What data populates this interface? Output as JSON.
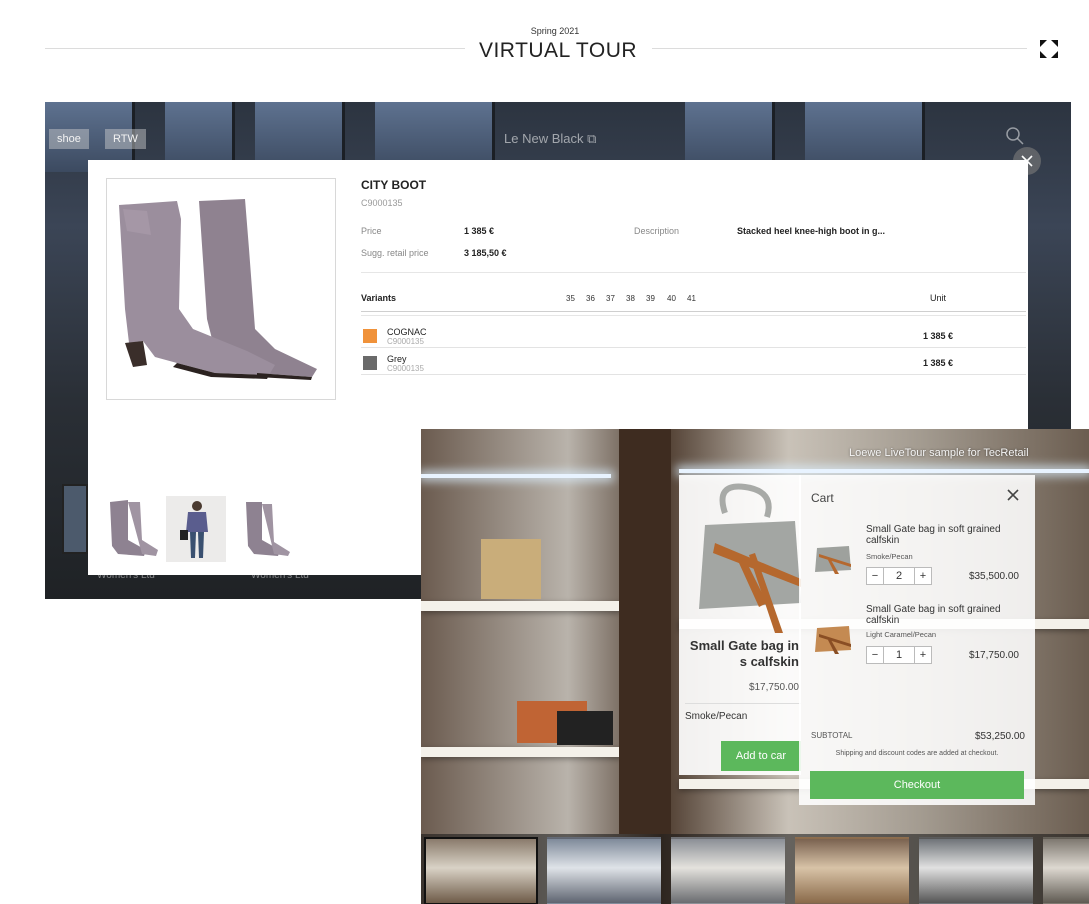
{
  "header": {
    "season": "Spring 2021",
    "title": "VIRTUAL TOUR",
    "fullscreen_icon": "fullscreen-icon"
  },
  "back_scene": {
    "tags": [
      "shoe",
      "RTW"
    ],
    "brand": "Le New Black",
    "floor_labels": [
      "Women's Ltd",
      "Women's Ltd"
    ]
  },
  "product": {
    "title": "CITY BOOT",
    "sku": "C9000135",
    "price_label": "Price",
    "price": "1 385 €",
    "retail_label": "Sugg. retail price",
    "retail_price": "3 185,50 €",
    "description_label": "Description",
    "description": "Stacked heel knee-high boot in g...",
    "variants_header": "Variants",
    "sizes": [
      "35",
      "36",
      "37",
      "38",
      "39",
      "40",
      "41"
    ],
    "unit_header": "Unit",
    "variants": [
      {
        "name": "COGNAC",
        "sku": "C9000135",
        "price": "1 385 €",
        "color": "#f0923a"
      },
      {
        "name": "Grey",
        "sku": "C9000135",
        "price": "1 385 €",
        "color": "#6a6a6a"
      }
    ]
  },
  "loewe": {
    "brand": "Loewe LiveTour sample for TecRetail",
    "product_card": {
      "name": "Small Gate bag in s calfskin",
      "price": "$17,750.00",
      "variant": "Smoke/Pecan",
      "add_label": "Add to car"
    },
    "cart": {
      "title": "Cart",
      "items": [
        {
          "name": "Small Gate bag in soft grained calfskin",
          "variant": "Smoke/Pecan",
          "qty": "2",
          "price": "$35,500.00"
        },
        {
          "name": "Small Gate bag in soft grained calfskin",
          "variant": "Light Caramel/Pecan",
          "qty": "1",
          "price": "$17,750.00"
        }
      ],
      "subtotal_label": "SUBTOTAL",
      "subtotal": "$53,250.00",
      "shipping_note": "Shipping and discount codes are added at checkout.",
      "checkout_label": "Checkout"
    }
  }
}
